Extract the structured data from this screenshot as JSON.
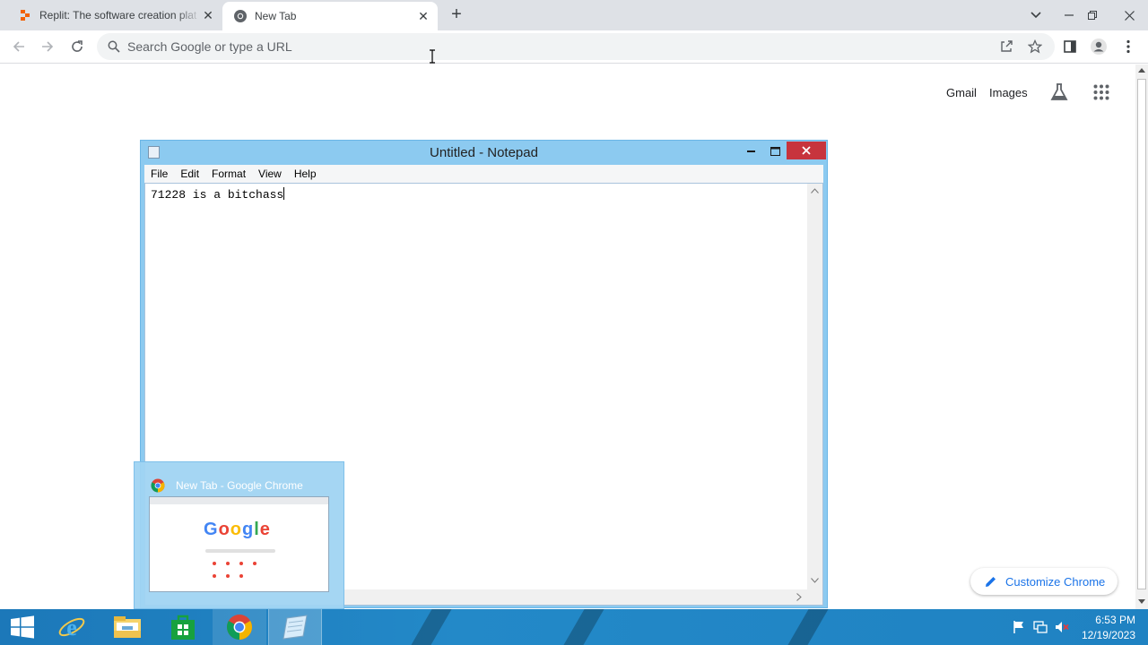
{
  "browser": {
    "tabs": [
      {
        "title": "Replit: The software creation plat",
        "icon": "replit-icon",
        "active": false
      },
      {
        "title": "New Tab",
        "icon": "chrome-icon",
        "active": true
      }
    ],
    "omnibox": {
      "placeholder": "Search Google or type a URL"
    }
  },
  "newtab_page": {
    "links": {
      "gmail": "Gmail",
      "images": "Images"
    },
    "customize_label": "Customize Chrome"
  },
  "notepad": {
    "title": "Untitled - Notepad",
    "menu": [
      "File",
      "Edit",
      "Format",
      "View",
      "Help"
    ],
    "content": "71228 is a bitchass"
  },
  "taskbar_thumbnail": {
    "title": "New Tab - Google Chrome"
  },
  "taskbar": {
    "apps": [
      "start-icon",
      "internet-explorer-icon",
      "file-explorer-icon",
      "store-icon",
      "chrome-icon",
      "notepad-icon"
    ],
    "clock_time": "6:53 PM",
    "clock_date": "12/19/2023"
  },
  "colors": {
    "accent_blue": "#1a73e8",
    "notepad_frame": "#8ccaf0",
    "close_red": "#c7343d",
    "taskbar": "#1f82c2"
  }
}
